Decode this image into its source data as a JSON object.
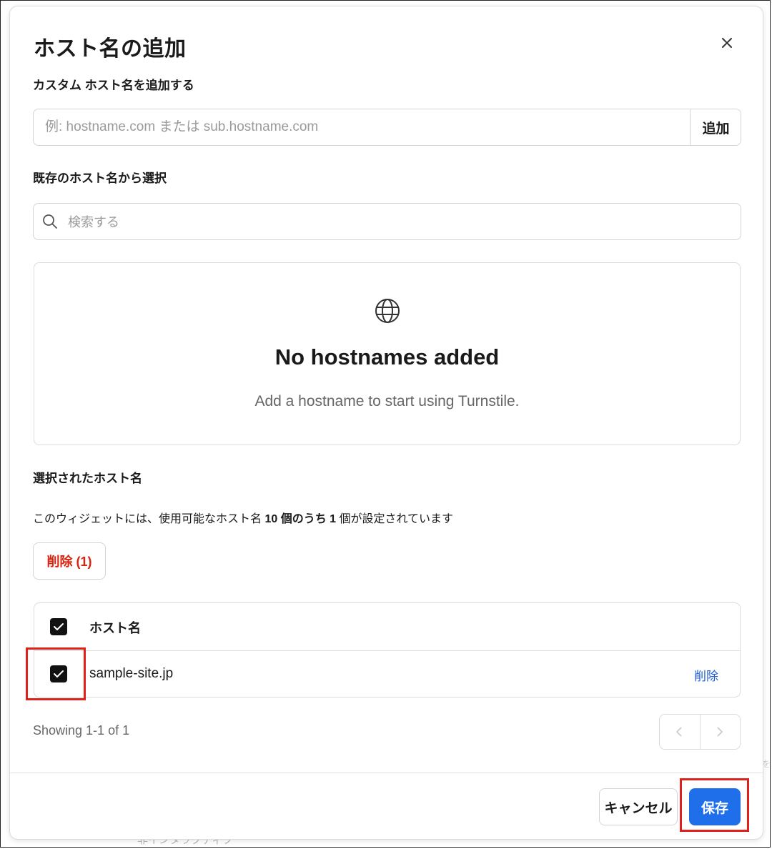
{
  "background": {
    "obscured_text": "非インタラクティブ",
    "right_edge_text": "を"
  },
  "modal": {
    "title": "ホスト名の追加",
    "close_icon": "close-icon",
    "custom_section": {
      "label": "カスタム ホスト名を追加する",
      "input_placeholder": "例: hostname.com または sub.hostname.com",
      "input_value": "",
      "add_label": "追加"
    },
    "existing_section": {
      "label": "既存のホスト名から選択",
      "search_placeholder": "検索する",
      "search_icon": "search-icon"
    },
    "empty_state": {
      "icon": "globe-icon",
      "title": "No hostnames added",
      "subtitle": "Add a hostname to start using Turnstile."
    },
    "selected_section": {
      "label": "選択されたホスト名",
      "info_prefix": "このウィジェットには、使用可能なホスト名 ",
      "info_count_total": "10 個のうち 1",
      "info_suffix": " 個が設定されています",
      "delete_selected_label": "削除 (1)"
    },
    "table": {
      "header": {
        "column": "ホスト名",
        "checked": true
      },
      "rows": [
        {
          "hostname": "sample-site.jp",
          "checked": true,
          "action": "削除"
        }
      ]
    },
    "pagination": {
      "showing": "Showing 1-1 of 1"
    },
    "footer": {
      "cancel_label": "キャンセル",
      "save_label": "保存"
    }
  },
  "colors": {
    "primary": "#1f6feb",
    "danger": "#d9230f",
    "link": "#1f5fd6",
    "highlight": "#e0201b"
  }
}
